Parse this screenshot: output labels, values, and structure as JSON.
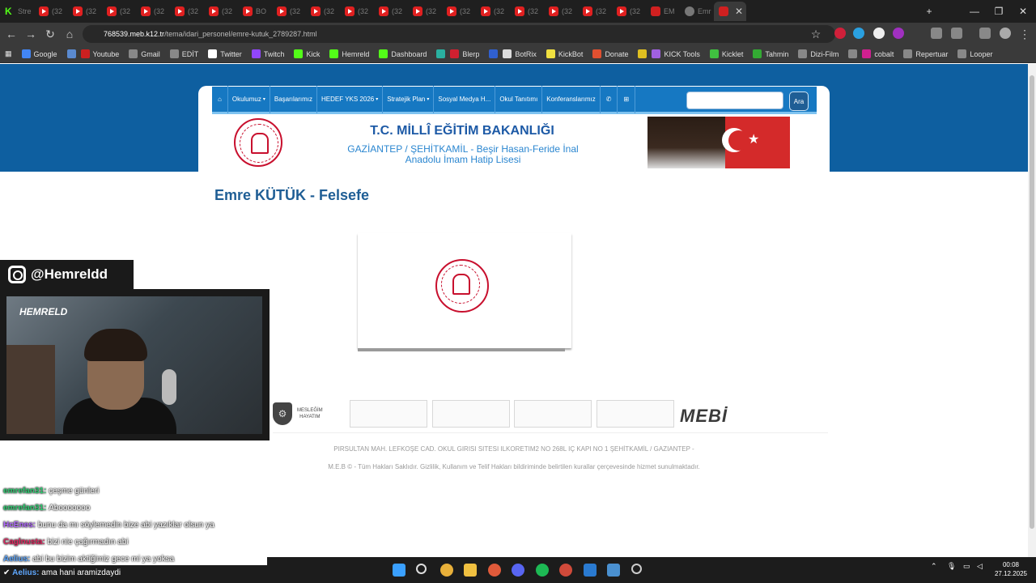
{
  "browser": {
    "tabs": [
      {
        "label": "Stre",
        "icon": "kick-icon"
      },
      {
        "label": "(32",
        "icon": "youtube-icon"
      },
      {
        "label": "(32",
        "icon": "youtube-icon"
      },
      {
        "label": "(32",
        "icon": "youtube-icon"
      },
      {
        "label": "(32",
        "icon": "youtube-icon"
      },
      {
        "label": "(32",
        "icon": "youtube-icon"
      },
      {
        "label": "(32",
        "icon": "youtube-icon"
      },
      {
        "label": "BO",
        "icon": "youtube-icon"
      },
      {
        "label": "(32",
        "icon": "youtube-icon"
      },
      {
        "label": "(32",
        "icon": "youtube-icon"
      },
      {
        "label": "(32",
        "icon": "youtube-icon"
      },
      {
        "label": "(32",
        "icon": "youtube-icon"
      },
      {
        "label": "(32",
        "icon": "youtube-icon"
      },
      {
        "label": "(32",
        "icon": "youtube-icon"
      },
      {
        "label": "(32",
        "icon": "youtube-icon"
      },
      {
        "label": "(32",
        "icon": "youtube-icon"
      },
      {
        "label": "(32",
        "icon": "youtube-icon"
      },
      {
        "label": "(32",
        "icon": "youtube-icon"
      },
      {
        "label": "(32",
        "icon": "youtube-icon"
      },
      {
        "label": "EM",
        "icon": "red-icon"
      },
      {
        "label": "Emr",
        "icon": "globe-icon"
      }
    ],
    "url_host": "768539.meb.k12.tr",
    "url_path": "/tema/idari_personel/emre-kutuk_2789287.html",
    "bookmarks": [
      "Google",
      "",
      "Youtube",
      "Gmail",
      "EDİT",
      "Twitter",
      "Twitch",
      "Kick",
      "Hemreld",
      "Dashboard",
      "",
      "Blerp",
      "",
      "BotRix",
      "KickBot",
      "Donate",
      "",
      "KICK Tools",
      "Kicklet",
      "Tahmin",
      "Dizi-Film",
      "",
      "cobalt",
      "Repertuar",
      "Looper"
    ]
  },
  "site": {
    "nav": [
      {
        "label": "",
        "icon": "home-icon"
      },
      {
        "label": "Okulumuz",
        "caret": true
      },
      {
        "label": "Başarılarımız",
        "caret": false
      },
      {
        "label": "HEDEF YKS 2026",
        "caret": true
      },
      {
        "label": "Stratejik Plan",
        "caret": true
      },
      {
        "label": "Sosyal Medya H...",
        "caret": false
      },
      {
        "label": "Okul Tanıtımı",
        "caret": false
      },
      {
        "label": "Konferanslarımız",
        "caret": false
      },
      {
        "label": "",
        "icon": "phone-icon"
      },
      {
        "label": "",
        "icon": "sitemap-icon"
      }
    ],
    "search_button": "Ara",
    "header_title": "T.C. MİLLÎ EĞİTİM BAKANLIĞI",
    "header_sub_1": "GAZİANTEP / ŞEHİTKAMİL - Beşir Hasan-Feride İnal",
    "header_sub_2": "Anadolu İmam Hatip Lisesi",
    "person_title": "Emre KÜTÜK - Felsefe",
    "meslek_line1": "MESLEĞİM",
    "meslek_line2": "HAYATIM",
    "mebi_logo": "MEBİ",
    "footer_address": "PIRSULTAN MAH. LEFKOŞE CAD. OKUL GIRISI SITESI ILKORETIM2 NO 268L IÇ KAPI NO 1 ŞEHİTKAMİL / GAZIANTEP -",
    "footer_copyright": "M.E.B © - Tüm Hakları Saklıdır. Gizlilik, Kullanım ve Telif Hakları bildiriminde belirtilen kurallar çerçevesinde hizmet sunulmaktadır."
  },
  "overlay": {
    "instagram_handle": "@Hemreldd",
    "cam_logo": "HEMRELD",
    "chat": [
      {
        "name": "emrefan31:",
        "text": "çeşme günleri",
        "color": "green"
      },
      {
        "name": "emrefan31:",
        "text": "Abooooooo",
        "color": "green"
      },
      {
        "name": "HcEnes:",
        "text": "bunu da mı söylemedin bize abi yazıklar olsun ya",
        "color": "purple"
      },
      {
        "name": "Caglnusta:",
        "text": "bizi nie çağırmadın abi",
        "color": "red"
      },
      {
        "name": "Aelius:",
        "text": "abi bu bizim aktiğimiz gece mi ya yoksa",
        "color": "blue"
      }
    ],
    "last_chat_name": "Aelius:",
    "last_chat_text": "ama hani aramizdaydi"
  },
  "taskbar": {
    "time": "00:08",
    "date": "27.12.2025"
  }
}
